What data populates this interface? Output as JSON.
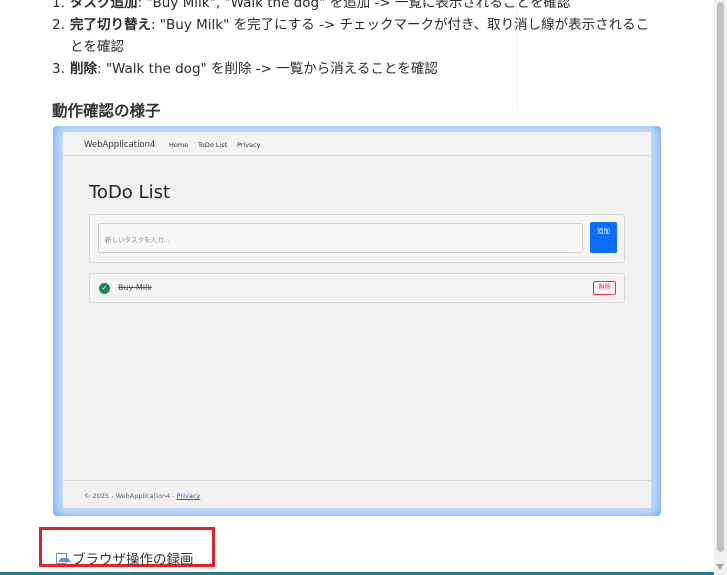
{
  "steps": [
    {
      "num": "1.",
      "bold": "タスク追加",
      "rest": ": \"Buy Milk\", \"Walk the dog\" を追加 -> 一覧に表示されることを確認"
    },
    {
      "num": "2.",
      "bold": "完了切り替え",
      "rest": ": \"Buy Milk\" を完了にする -> チェックマークが付き、取り消し線が表示されることを確認"
    },
    {
      "num": "3.",
      "bold": "削除",
      "rest": ": \"Walk the dog\" を削除 -> 一覧から消えることを確認"
    }
  ],
  "section_heading": "動作確認の様子",
  "screenshot": {
    "brand": "WebApplication4",
    "nav": [
      "Home",
      "ToDo List",
      "Privacy"
    ],
    "title": "ToDo List",
    "input_placeholder": "新しいタスクを入力...",
    "add_button": "追加",
    "items": [
      {
        "text": "Buy Milk",
        "done": true,
        "delete_label": "削除"
      }
    ],
    "footer_text": "© 2025 - WebApplication4 - ",
    "footer_link": "Privacy"
  },
  "recording_link": "ブラウザ操作の録画",
  "colors": {
    "accent_blue": "#4f97f5",
    "highlight_red": "#e3222b",
    "bottom_line": "#1d7f8a"
  }
}
